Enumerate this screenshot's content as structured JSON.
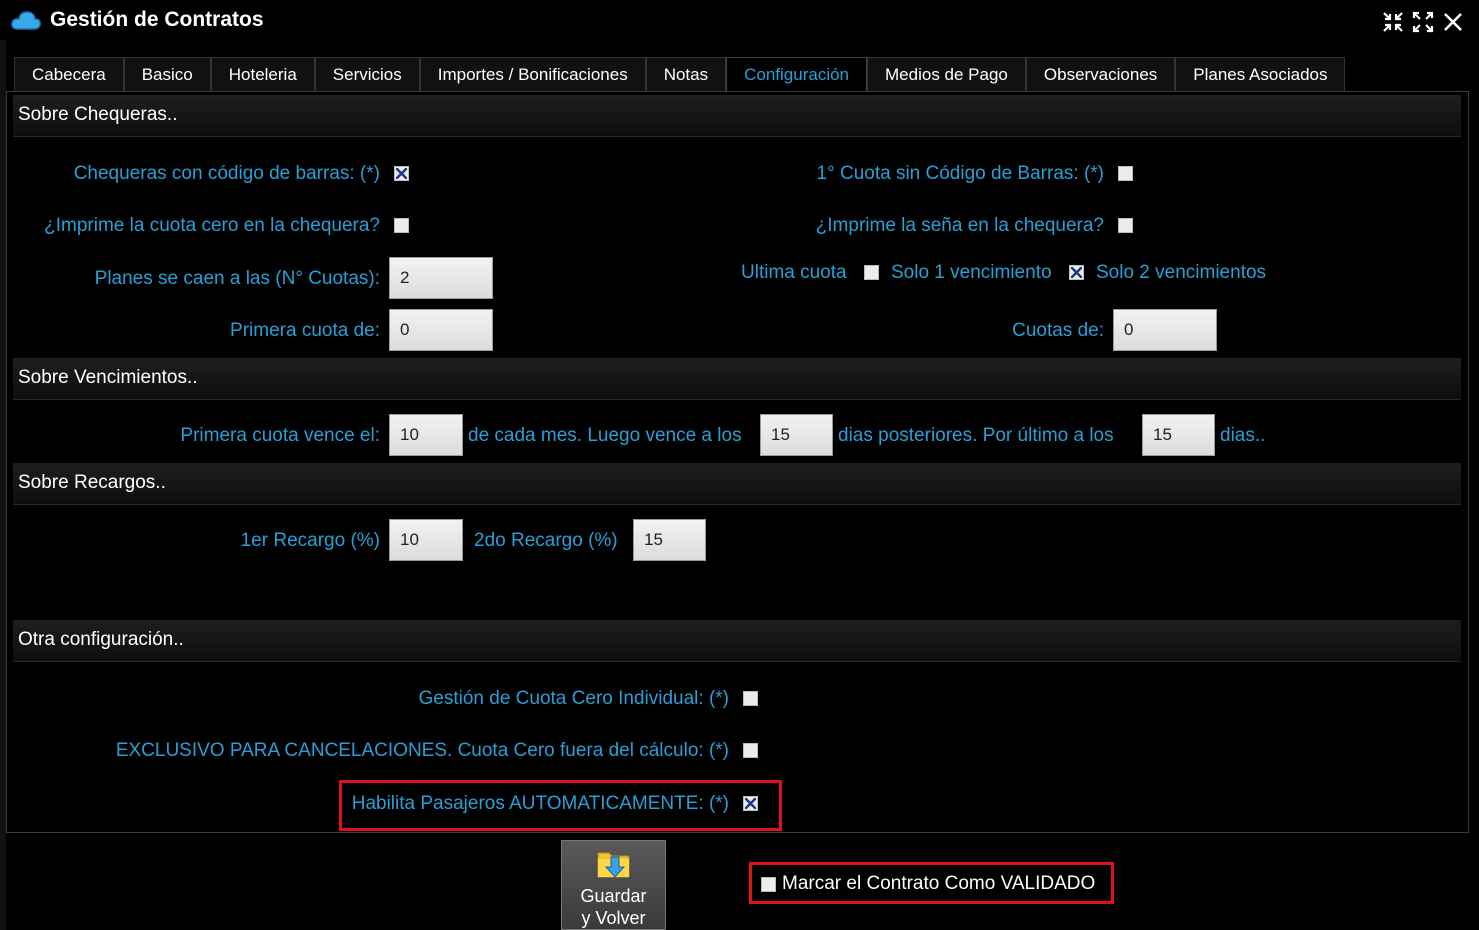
{
  "window": {
    "title": "Gestión de Contratos",
    "cloud_icon": "cloud-icon",
    "controls": [
      "collapse-icon",
      "expand-icon",
      "close-icon"
    ]
  },
  "tabs": [
    {
      "label": "Cabecera",
      "active": false
    },
    {
      "label": "Basico",
      "active": false
    },
    {
      "label": "Hoteleria",
      "active": false
    },
    {
      "label": "Servicios",
      "active": false
    },
    {
      "label": "Importes / Bonificaciones",
      "active": false
    },
    {
      "label": "Notas",
      "active": false
    },
    {
      "label": "Configuración",
      "active": true
    },
    {
      "label": "Medios de Pago",
      "active": false
    },
    {
      "label": "Observaciones",
      "active": false
    },
    {
      "label": "Planes Asociados",
      "active": false
    }
  ],
  "chequeras": {
    "title": "Sobre Chequeras..",
    "codigo_barras_label": "Chequeras con código de barras: (*)",
    "codigo_barras_checked": true,
    "primera_sin_codigo_label": "1° Cuota sin Código de Barras: (*)",
    "primera_sin_codigo_checked": false,
    "imprime_cuota_cero_label": "¿Imprime la cuota cero en la chequera?",
    "imprime_cuota_cero_checked": false,
    "imprime_sena_label": "¿Imprime la seña en la chequera?",
    "imprime_sena_checked": false,
    "planes_caen_label": "Planes se caen a las (N° Cuotas):",
    "planes_caen_value": "2",
    "ultima_cuota_label": "Ultima cuota",
    "ultima_cuota_checked": false,
    "solo1_label": "Solo 1 vencimiento",
    "solo1_checked": true,
    "solo2_label": "Solo 2 vencimientos",
    "primera_cuota_label": "Primera cuota de:",
    "primera_cuota_value": "0",
    "cuotas_de_label": "Cuotas de:",
    "cuotas_de_value": "0"
  },
  "vencimientos": {
    "title": "Sobre Vencimientos..",
    "primera_vence_label": "Primera cuota vence el:",
    "primera_vence_value": "10",
    "cada_mes_label": "de cada mes. Luego vence a los",
    "luego_value": "15",
    "dias_post_label": "dias posteriores. Por último a los",
    "ultimo_value": "15",
    "dias_label": "dias.."
  },
  "recargos": {
    "title": "Sobre Recargos..",
    "recargo1_label": "1er Recargo (%)",
    "recargo1_value": "10",
    "recargo2_label": "2do Recargo (%)",
    "recargo2_value": "15"
  },
  "otra": {
    "title": "Otra configuración..",
    "cuota_cero_individual_label": "Gestión de Cuota Cero Individual: (*)",
    "cuota_cero_individual_checked": false,
    "exclusivo_label": "EXCLUSIVO PARA CANCELACIONES. Cuota Cero fuera del cálculo: (*)",
    "exclusivo_checked": false,
    "habilita_label": "Habilita Pasajeros AUTOMATICAMENTE: (*)",
    "habilita_checked": true
  },
  "footer": {
    "save_label": "Guardar\ny Volver",
    "save_icon": "folder-download-icon",
    "validado_label": "Marcar el Contrato Como VALIDADO",
    "validado_checked": false
  },
  "colors": {
    "accent": "#2a9fd6",
    "highlight": "#e0101a",
    "background": "#000000"
  }
}
